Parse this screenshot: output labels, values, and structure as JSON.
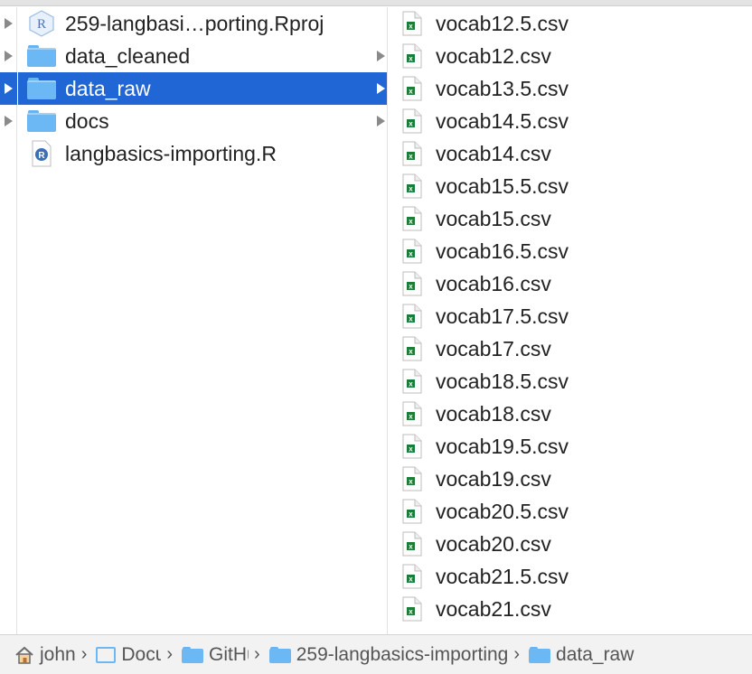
{
  "colors": {
    "selection": "#2166d5",
    "folder": "#6cb8f5",
    "csv_badge": "#1e7b3a"
  },
  "middle_column": {
    "items": [
      {
        "label": "259-langbasi…porting.Rproj",
        "icon": "rproj-icon",
        "selected": false,
        "has_children": false
      },
      {
        "label": "data_cleaned",
        "icon": "folder-icon",
        "selected": false,
        "has_children": true
      },
      {
        "label": "data_raw",
        "icon": "folder-icon",
        "selected": true,
        "has_children": true
      },
      {
        "label": "docs",
        "icon": "folder-icon",
        "selected": false,
        "has_children": true
      },
      {
        "label": "langbasics-importing.R",
        "icon": "r-script-icon",
        "selected": false,
        "has_children": false
      }
    ]
  },
  "right_column": {
    "files": [
      "vocab12.5.csv",
      "vocab12.csv",
      "vocab13.5.csv",
      "vocab14.5.csv",
      "vocab14.csv",
      "vocab15.5.csv",
      "vocab15.csv",
      "vocab16.5.csv",
      "vocab16.csv",
      "vocab17.5.csv",
      "vocab17.csv",
      "vocab18.5.csv",
      "vocab18.csv",
      "vocab19.5.csv",
      "vocab19.csv",
      "vocab20.5.csv",
      "vocab20.csv",
      "vocab21.5.csv",
      "vocab21.csv"
    ]
  },
  "path_bar": {
    "crumbs": [
      {
        "label": "john",
        "icon": "home-icon"
      },
      {
        "label": "Documents",
        "icon": "documents-folder-icon"
      },
      {
        "label": "GitHub",
        "icon": "folder-icon"
      },
      {
        "label": "259-langbasics-importing",
        "icon": "folder-icon"
      },
      {
        "label": "data_raw",
        "icon": "folder-icon"
      }
    ],
    "separator": "›"
  }
}
